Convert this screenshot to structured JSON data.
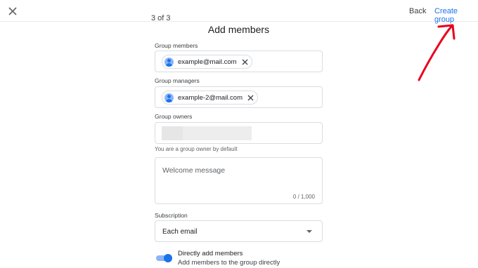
{
  "header": {
    "step": "3 of 3",
    "back_label": "Back",
    "create_label": "Create group"
  },
  "page": {
    "title": "Add members"
  },
  "members": {
    "label": "Group members",
    "chip": "example@mail.com"
  },
  "managers": {
    "label": "Group managers",
    "chip": "example-2@mail.com"
  },
  "owners": {
    "label": "Group owners",
    "helper": "You are a group owner by default"
  },
  "welcome": {
    "placeholder": "Welcome message",
    "counter": "0 / 1,000"
  },
  "subscription": {
    "label": "Subscription",
    "value": "Each email"
  },
  "direct_add": {
    "title": "Directly add members",
    "description": "Add members to the group directly",
    "enabled": true
  },
  "colors": {
    "accent": "#1a73e8",
    "annotation": "#e8001c"
  },
  "icons": {
    "close": "close-icon",
    "chip_avatar": "avatar-icon",
    "chip_remove": "close-icon",
    "dropdown": "dropdown-arrow-icon"
  }
}
